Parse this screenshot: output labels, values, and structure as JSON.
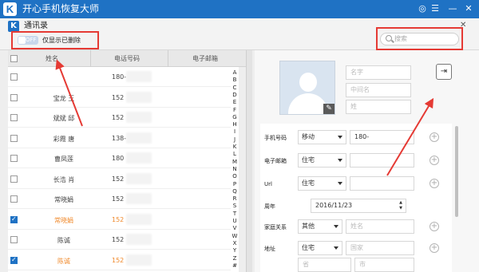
{
  "app": {
    "title": "开心手机恢复大师",
    "logo_letter": "K"
  },
  "window": {
    "title": "通讯录",
    "logo_letter": "K"
  },
  "toolbar": {
    "toggle_label": "OFF",
    "only_deleted_label": "仅显示已删除",
    "search_placeholder": "搜索"
  },
  "table": {
    "headers": [
      "姓名",
      "电话号码",
      "电子邮箱"
    ],
    "rows": [
      {
        "name": "",
        "phone": "180-",
        "checked": false,
        "highlight": false
      },
      {
        "name": "宝龙 王",
        "phone": "152",
        "checked": false,
        "highlight": false
      },
      {
        "name": "斌斌 邱",
        "phone": "152",
        "checked": false,
        "highlight": false
      },
      {
        "name": "彩霞 唐",
        "phone": "138-",
        "checked": false,
        "highlight": false
      },
      {
        "name": "曹凤莲",
        "phone": "180",
        "checked": false,
        "highlight": false
      },
      {
        "name": "长浩 肖",
        "phone": "152",
        "checked": false,
        "highlight": false
      },
      {
        "name": "常晓娟",
        "phone": "152",
        "checked": false,
        "highlight": false
      },
      {
        "name": "常晓娟",
        "phone": "152",
        "checked": true,
        "highlight": true
      },
      {
        "name": "陈诚",
        "phone": "152",
        "checked": false,
        "highlight": false
      },
      {
        "name": "陈诚",
        "phone": "152",
        "checked": true,
        "highlight": true
      }
    ],
    "alphabet": [
      "A",
      "B",
      "C",
      "D",
      "E",
      "F",
      "G",
      "H",
      "I",
      "J",
      "K",
      "L",
      "M",
      "N",
      "O",
      "P",
      "Q",
      "R",
      "S",
      "T",
      "U",
      "V",
      "W",
      "X",
      "Y",
      "Z",
      "#"
    ]
  },
  "detail": {
    "name_placeholders": {
      "first": "名字",
      "middle": "中间名",
      "last": "姓"
    },
    "phone": {
      "label": "手机号码",
      "type": "移动",
      "value": "180-"
    },
    "email": {
      "label": "电子邮箱",
      "type": "住宅"
    },
    "url": {
      "label": "Url",
      "type": "住宅"
    },
    "anniversary": {
      "label": "周年",
      "value": "2016/11/23"
    },
    "family": {
      "label": "家庭关系",
      "type": "其他",
      "placeholder": "姓名"
    },
    "address": {
      "label": "地址",
      "type": "住宅",
      "country_placeholder": "国家",
      "province_placeholder": "省",
      "city_placeholder": "市"
    },
    "plus_symbol": "+"
  },
  "icons": {
    "wechat": "wechat-icon",
    "chat": "chat-icon",
    "minimize": "minimize-icon",
    "close": "close-icon",
    "edit": "pencil-icon",
    "export": "export-icon"
  },
  "colors": {
    "titlebar": "#1f72c4",
    "annotation": "#e53a34",
    "highlight_row": "#f08a2c"
  }
}
